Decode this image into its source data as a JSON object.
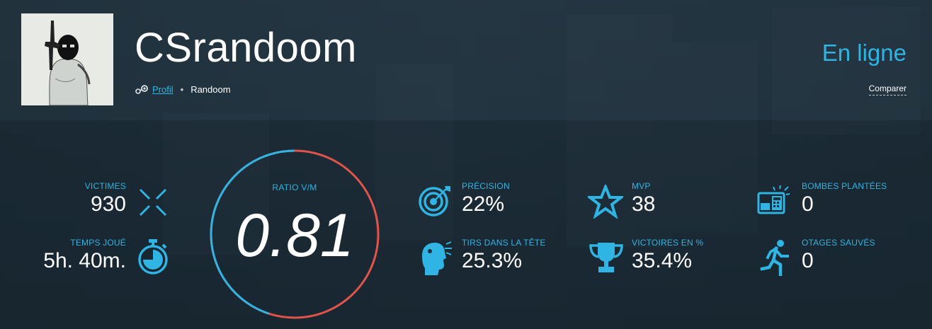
{
  "player": {
    "name": "CSrandoom",
    "profile_link": "Profil",
    "separator": "•",
    "clan": "Randoom",
    "status": "En ligne",
    "compare_label": "Comparer"
  },
  "stats_left": [
    {
      "label": "VICTIMES",
      "value": "930",
      "icon": "crosshair-x-icon"
    },
    {
      "label": "TEMPS JOUÉ",
      "value": "5h. 40m.",
      "icon": "stopwatch-icon"
    }
  ],
  "ratio": {
    "label": "RATIO V/M",
    "value": "0.81",
    "kill_fraction": 0.45
  },
  "stats_right": [
    {
      "label": "PRÉCISION",
      "value": "22%",
      "icon": "target-icon"
    },
    {
      "label": "TIRS DANS LA TÊTE",
      "value": "25.3%",
      "icon": "headshot-icon"
    },
    {
      "label": "MVP",
      "value": "38",
      "icon": "star-icon"
    },
    {
      "label": "VICTOIRES EN %",
      "value": "35.4%",
      "icon": "trophy-icon"
    },
    {
      "label": "BOMBES PLANTÉES",
      "value": "0",
      "icon": "c4-bomb-icon"
    },
    {
      "label": "OTAGES SAUVÉS",
      "value": "0",
      "icon": "running-man-icon"
    }
  ],
  "colors": {
    "accent": "#2fb4e4",
    "ratio_kill": "#2fb4e4",
    "ratio_death": "#e0544a",
    "background": "#1c2b36"
  }
}
